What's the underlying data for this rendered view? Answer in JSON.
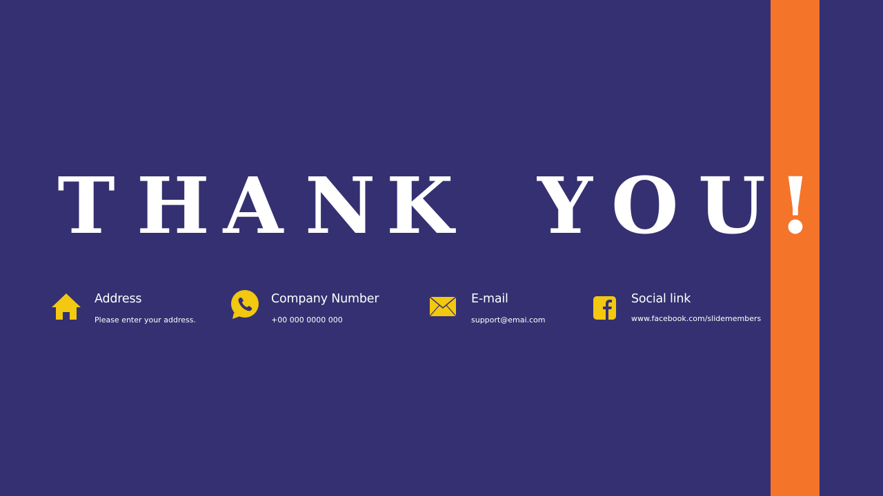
{
  "slide": {
    "headline_letters": [
      "T",
      "H",
      "A",
      "N",
      "K",
      "Y",
      "O",
      "U"
    ],
    "exclamation": "!",
    "colors": {
      "background": "#343071",
      "accent_bar": "#F4742A",
      "icon": "#F2C811",
      "text": "#FFFFFF"
    }
  },
  "contacts": [
    {
      "icon": "home-icon",
      "title": "Address",
      "text": "Please  enter  your address."
    },
    {
      "icon": "whatsapp-phone-icon",
      "title": "Company Number",
      "text": "+00 000 0000 000"
    },
    {
      "icon": "envelope-icon",
      "title": "E-mail",
      "text": "support@emai.com"
    },
    {
      "icon": "facebook-icon",
      "title": "Social link",
      "text": "www.facebook.com/slidemembers"
    }
  ]
}
